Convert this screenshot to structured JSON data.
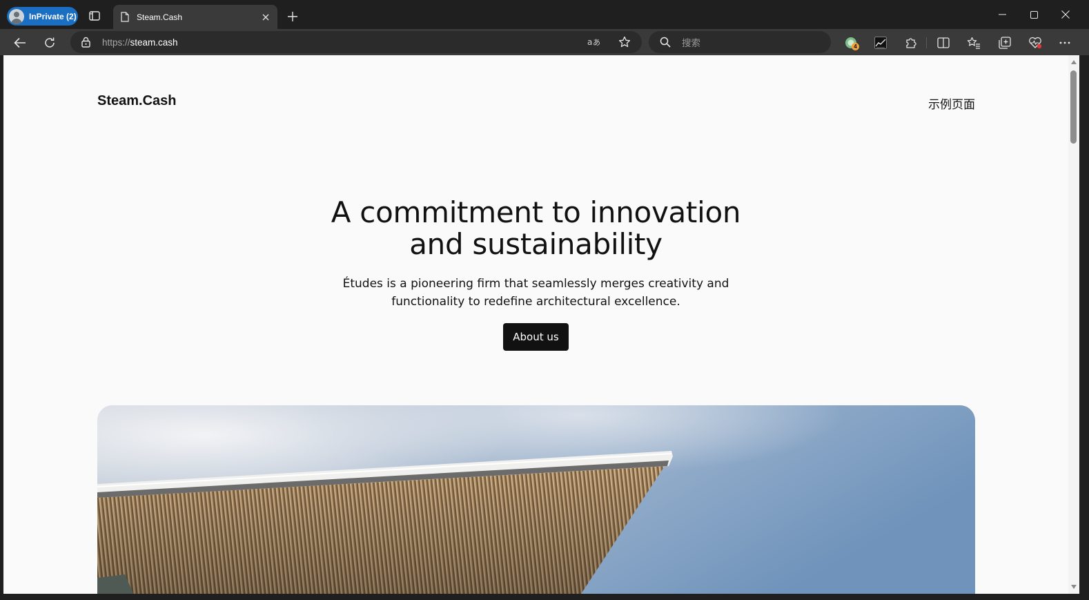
{
  "browser": {
    "profile_label": "InPrivate (2)",
    "tab_title": "Steam.Cash",
    "url_protocol": "https://",
    "url_host": "steam.cash",
    "search_placeholder": "搜索",
    "extension_badge_count": "4",
    "accent_color": "#1a6fc2"
  },
  "icons": {
    "tab_actions": "tab-actions-icon",
    "page": "page-icon",
    "close": "close-icon",
    "new_tab": "plus-icon",
    "minimize": "minimize-icon",
    "maximize": "maximize-icon",
    "window_close": "close-icon",
    "back": "back-arrow-icon",
    "refresh": "refresh-icon",
    "lock": "lock-icon",
    "read_aloud": "read-aloud-icon",
    "favorite": "star-icon",
    "search": "search-icon",
    "extensions": "puzzle-icon",
    "split_screen": "split-screen-icon",
    "favorites": "favorites-icon",
    "collections": "collections-icon",
    "health": "heart-icon",
    "more": "more-icon"
  },
  "site": {
    "logo": "Steam.Cash",
    "nav_link": "示例页面",
    "hero_title_line1": "A commitment to innovation",
    "hero_title_line2": "and sustainability",
    "hero_sub_line1": "Études is a pioneering firm that seamlessly merges creativity and",
    "hero_sub_line2": "functionality to redefine architectural excellence.",
    "cta_label": "About us"
  }
}
